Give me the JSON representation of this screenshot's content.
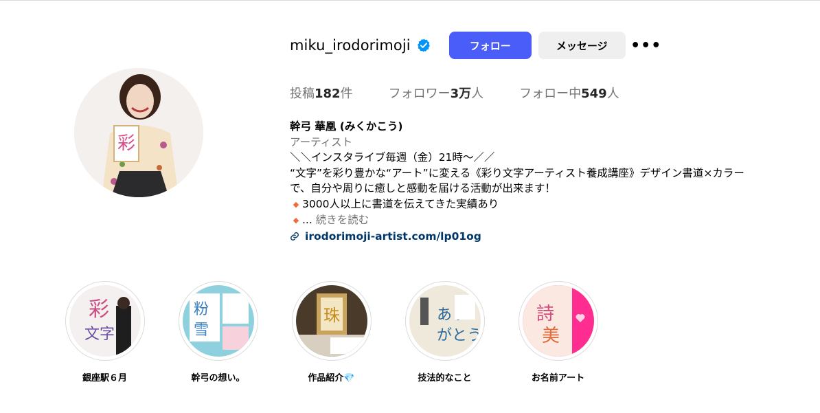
{
  "profile": {
    "username": "miku_irodorimoji",
    "verified_icon": "verified-badge-icon",
    "follow_label": "フォロー",
    "message_label": "メッセージ",
    "more_label": "•••"
  },
  "stats": {
    "posts_label": "投稿",
    "posts_value": "182",
    "posts_unit": "件",
    "followers_label": "フォロワー",
    "followers_value": "3万",
    "followers_unit": "人",
    "following_label": "フォロー中",
    "following_value": "549",
    "following_unit": "人"
  },
  "bio": {
    "name": "幹弓 華凰 (みくかこう)",
    "category": "アーティスト",
    "line1": "＼＼インスタライブ毎週（金）21時〜／／",
    "line2": "“文字”を彩り豊かな“アート”に変える《彩り文字アーティスト養成講座》デザイン書道×カラー",
    "line3": "で、自分や周りに癒しと感動を届ける活動が出来ます！",
    "line4": "3000人以上に書道を伝えてきた実績あり",
    "line5_prefix": "... ",
    "read_more": "続きを読む",
    "link": "irodorimoji-artist.com/lp01og",
    "bullet_icon": "orange-diamond-icon",
    "link_icon": "link-icon"
  },
  "highlights": [
    {
      "label": "銀座駅６月"
    },
    {
      "label": "幹弓の想い。"
    },
    {
      "label": "作品紹介",
      "emoji": "💎"
    },
    {
      "label": "技法的なこと"
    },
    {
      "label": "お名前アート"
    }
  ],
  "colors": {
    "follow_button": "#4a5df9",
    "link": "#00376b",
    "verified": "#0095f6",
    "bullet": "#f06b3a"
  }
}
